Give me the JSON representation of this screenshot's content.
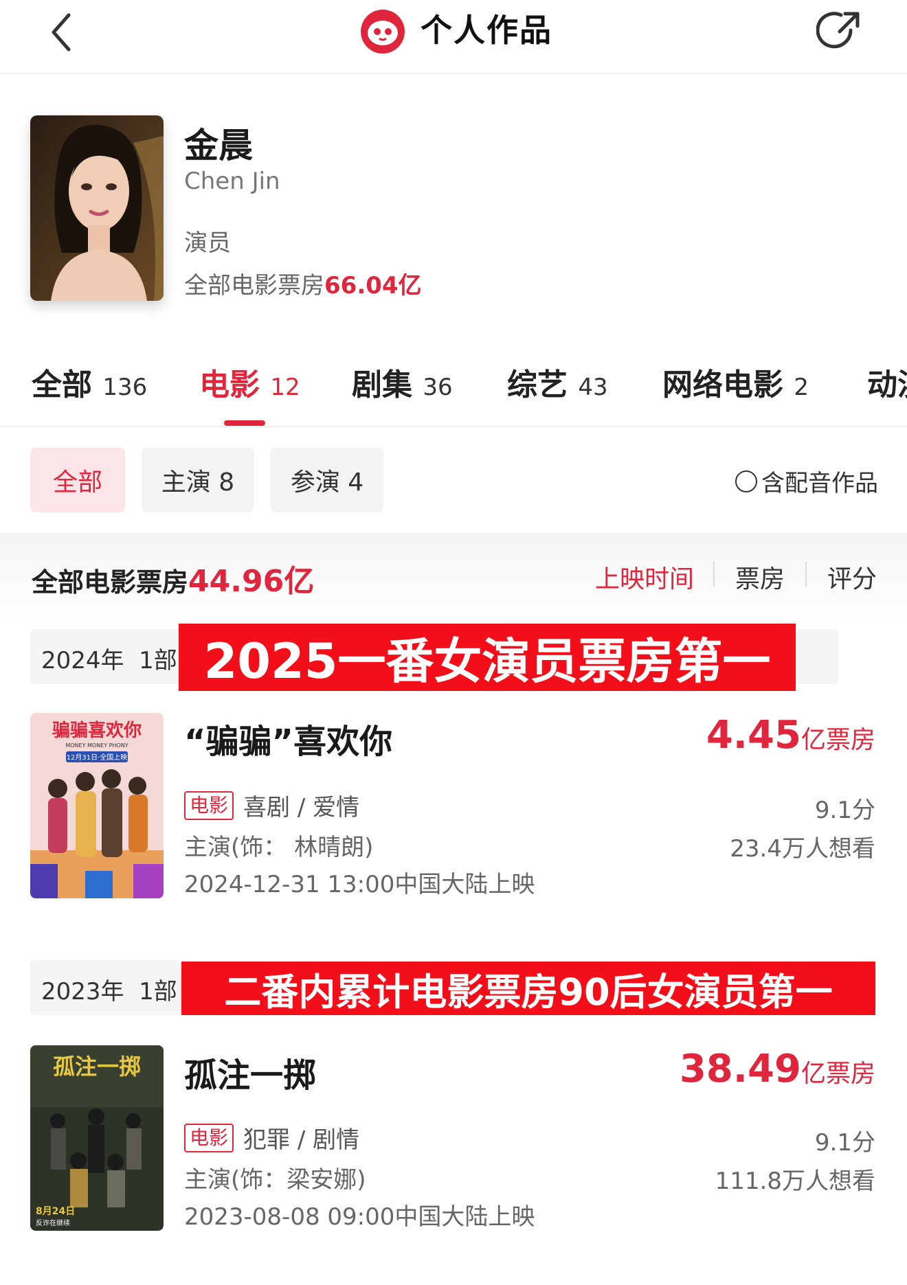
{
  "header": {
    "title": "个人作品",
    "back_icon": "chevron-left-icon",
    "logo_icon": "cat-logo-icon",
    "share_icon": "share-icon",
    "brand_color": "#e0263d"
  },
  "profile": {
    "name": "金晨",
    "english_name": "Chen Jin",
    "role": "演员",
    "box_label": "全部电影票房",
    "box_value": "66.04亿"
  },
  "tabs": [
    {
      "label": "全部",
      "count": "136"
    },
    {
      "label": "电影",
      "count": "12"
    },
    {
      "label": "剧集",
      "count": "36"
    },
    {
      "label": "综艺",
      "count": "43"
    },
    {
      "label": "网络电影",
      "count": "2"
    },
    {
      "label": "动漫",
      "count": ""
    }
  ],
  "filters": {
    "chips": [
      {
        "label": "全部"
      },
      {
        "label": "主演 8"
      },
      {
        "label": "参演 4"
      }
    ],
    "dub_label": "含配音作品"
  },
  "summary": {
    "label": "全部电影票房",
    "value": "44.96亿",
    "sorts": [
      "上映时间",
      "票房",
      "评分"
    ]
  },
  "sections": [
    {
      "year": "2024年",
      "count": "1部",
      "banner": "2025一番女演员票房第一",
      "movie": {
        "title": "“骗骗”喜欢你",
        "box_big": "4.45",
        "box_unit": "亿票房",
        "tag": "电影",
        "genre": "喜剧 / 爱情",
        "role": "主演(饰：  林晴朗)",
        "release": "2024-12-31 13:00中国大陆上映",
        "score": "9.1分",
        "want": "23.4万人想看",
        "poster_title": "骗骗喜欢你",
        "poster_sub": "MONEY MONEY PHONY",
        "poster_date": "12月31日·全国上映"
      }
    },
    {
      "year": "2023年",
      "count": "1部",
      "banner": "二番内累计电影票房90后女演员第一",
      "movie": {
        "title": "孤注一掷",
        "box_big": "38.49",
        "box_unit": "亿票房",
        "tag": "电影",
        "genre": "犯罪 / 剧情",
        "role": "主演(饰：梁安娜)",
        "release": "2023-08-08 09:00中国大陆上映",
        "score": "9.1分",
        "want": "111.8万人想看",
        "poster_title": "孤注一掷",
        "poster_date": "8月24日",
        "poster_sub": "反诈在继续"
      }
    }
  ]
}
